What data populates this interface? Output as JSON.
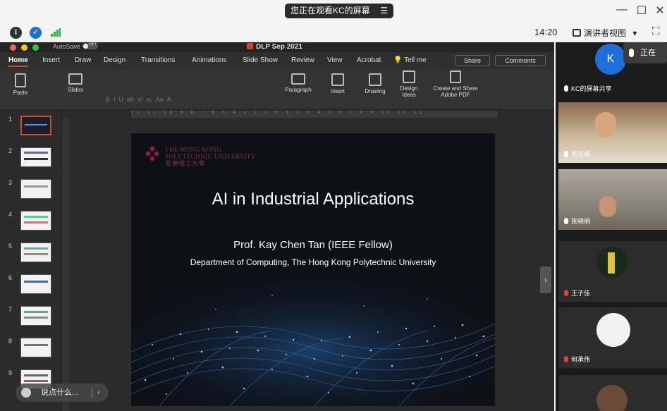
{
  "banner": {
    "sharing_text": "您正在观看KC的屏幕",
    "expand_icon": "list-icon",
    "window_controls": [
      "—",
      "☐",
      "✕"
    ]
  },
  "meeting_bar": {
    "time": "14:20",
    "presenter_view": "演讲者视图",
    "presenter_dropdown": "▾",
    "fullscreen_icon": "⛶"
  },
  "ppt": {
    "autosave": "AutoSave",
    "doc_title": "DLP Sep 2021",
    "tabs": [
      "Home",
      "Insert",
      "Draw",
      "Design",
      "Transitions",
      "Animations",
      "Slide Show",
      "Review",
      "View",
      "Acrobat",
      "Tell me"
    ],
    "share": "Share",
    "comments": "Comments",
    "ribbon": {
      "paste": "Paste",
      "slides": "Slides",
      "paragraph": "Paragraph",
      "insert": "Insert",
      "drawing": "Drawing",
      "design_ideas": "Design\nIdeas",
      "create_pdf": "Create and Share\nAdobe PDF"
    },
    "ruler": "12 11 10 9 8 7 6 5 4 3 2 1 0 1 2 3 4 5 6 7 8 9 10 11 12",
    "slide_numbers": [
      "1",
      "2",
      "3",
      "4",
      "5",
      "6",
      "7",
      "8",
      "9"
    ],
    "slide": {
      "university_en_1": "THE HONG KONG",
      "university_en_2": "POLYTECHNIC UNIVERSITY",
      "university_zh": "香港理工大學",
      "title": "AI in Industrial Applications",
      "author": "Prof. Kay Chen Tan (IEEE Fellow)",
      "department": "Department of Computing, The Hong Kong Polytechnic University"
    },
    "chat_placeholder": "说点什么..."
  },
  "participants": {
    "mute_label": "正在",
    "host": {
      "initial": "K",
      "name": "KC的屏幕共享"
    },
    "tiles": [
      {
        "name": "熊志辉"
      },
      {
        "name": "张晓明"
      },
      {
        "name": "王子佳"
      },
      {
        "name": "何承伟"
      }
    ]
  }
}
